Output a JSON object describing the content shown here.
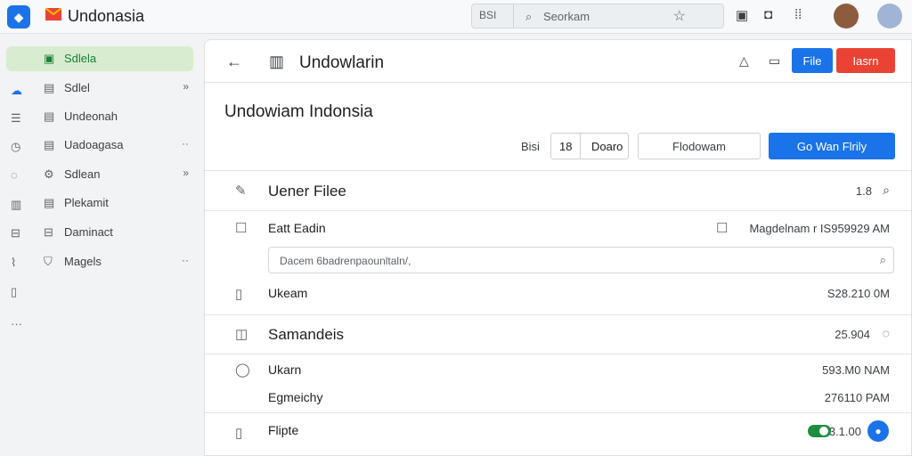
{
  "header": {
    "app_title": "Undonasia",
    "search_chip": "BSI",
    "search_placeholder": "Seorkam",
    "brand_color": "#1a73e8"
  },
  "sidebar": {
    "items": [
      {
        "label": "Sdlela",
        "active": true
      },
      {
        "label": "Sdlel",
        "arrow": "»"
      },
      {
        "label": "Undeonah"
      },
      {
        "label": "Uadoagasa",
        "arrow": "··"
      },
      {
        "label": "Sdlean",
        "arrow": "»"
      },
      {
        "label": "Plekamit"
      },
      {
        "label": "Daminact"
      },
      {
        "label": "Magels",
        "arrow": "··"
      }
    ],
    "more": "···"
  },
  "main": {
    "title": "Undowlarin",
    "file_button": "File",
    "red_button": "Iasrn",
    "subtitle": "Undowiam Indonsia",
    "small_label": "Bisi",
    "segment_a": "18",
    "segment_b": "Doaro",
    "outline_button": "Flodowam",
    "primary_button": "Go Wan Flrily"
  },
  "rows": {
    "section1_title": "Uener Filee",
    "section1_meta": "1.8",
    "item1_title": "Eatt Eadin",
    "item1_meta": "Magdelnam r IS959929 AM",
    "note_placeholder": "Dacem 6badrenpaounltaln/,",
    "item2_title": "Ukeam",
    "item2_meta": "S28.210 0M",
    "section2_title": "Samandeis",
    "section2_meta": "25.904",
    "item3_title": "Ukarn",
    "item3_meta": "593.M0 NAM",
    "item4_title": "Egmeichy",
    "item4_meta": "276110 PAM",
    "item5_title": "Flipte",
    "item5_meta": "3.1.00"
  },
  "accent_colors": {
    "primary": "#1a73e8",
    "danger": "#ea4335",
    "success": "#1e8e3e",
    "active_nav": "#d8eccf"
  }
}
